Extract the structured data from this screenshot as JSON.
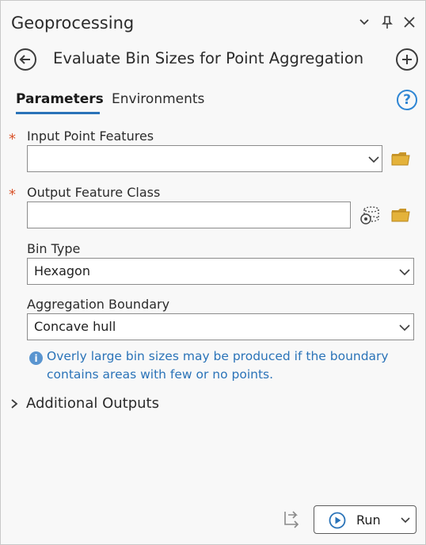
{
  "pane": {
    "title": "Geoprocessing",
    "controls": [
      "chevron-down-icon",
      "pin-icon",
      "close-icon"
    ]
  },
  "tool": {
    "title": "Evaluate Bin Sizes for Point Aggregation"
  },
  "tabs": [
    {
      "label": "Parameters",
      "active": true
    },
    {
      "label": "Environments",
      "active": false
    }
  ],
  "params": {
    "input_point_features": {
      "label": "Input Point Features",
      "required": true,
      "value": ""
    },
    "output_feature_class": {
      "label": "Output Feature Class",
      "required": true,
      "value": ""
    },
    "bin_type": {
      "label": "Bin Type",
      "value": "Hexagon"
    },
    "aggregation_boundary": {
      "label": "Aggregation Boundary",
      "value": "Concave hull"
    }
  },
  "info_message": "Overly large bin sizes may be produced if the boundary contains areas with few or no points.",
  "sections": {
    "additional_outputs": "Additional Outputs"
  },
  "footer": {
    "run_label": "Run"
  },
  "colors": {
    "accent": "#2a73b8",
    "required": "#d9542b",
    "folder": "#e4b23a"
  }
}
